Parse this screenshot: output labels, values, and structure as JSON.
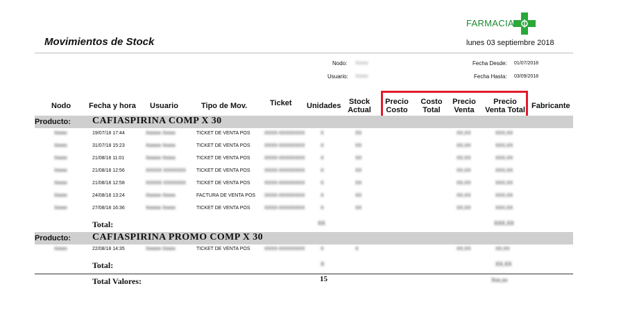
{
  "logo": {
    "text": "FARMACIA",
    "cross_color": "#2aa83a"
  },
  "report": {
    "title": "Movimientos de Stock",
    "date": "lunes 03 septiembre 2018"
  },
  "meta": {
    "nodo_label": "Nodo:",
    "nodo_value": "Xxxxx",
    "usuario_label": "Usuario:",
    "usuario_value": "Xxxxx",
    "fecha_desde_label": "Fecha Desde:",
    "fecha_desde_value": "01/07/2018",
    "fecha_hasta_label": "Fecha Hasta:",
    "fecha_hasta_value": "03/09/2018"
  },
  "columns": {
    "nodo": "Nodo",
    "fecha": "Fecha y hora",
    "usuario": "Usuario",
    "tipo": "Tipo de Mov.",
    "ticket": "Ticket",
    "unidades": "Unidades",
    "stock_1": "Stock",
    "stock_2": "Actual",
    "precio_costo_1": "Precio",
    "precio_costo_2": "Costo",
    "costo_total_1": "Costo",
    "costo_total_2": "Total",
    "precio_venta_1": "Precio",
    "precio_venta_2": "Venta",
    "pvt_1": "Precio",
    "pvt_2": "Venta Total",
    "fabricante": "Fabricante"
  },
  "highlight_color": "#e21b2a",
  "product_label": "Producto:",
  "total_label": "Total:",
  "total_valores_label": "Total Valores:",
  "total_valores_unidades": "15",
  "total_valores_venta": "Xxx,xx",
  "products": [
    {
      "name": "CAFIASPIRINA COMP X  30",
      "rows": [
        {
          "nodo": "Xxxxx",
          "fecha": "19/07/18 17:44",
          "usuario": "Xxxxxx Xxxxx",
          "tipo": "TICKET DE VENTA POS",
          "ticket": "XXXX-XXXXXXXX",
          "unidades": "X",
          "stock": "XX",
          "precio_venta": "XX,XX",
          "pvt": "XXX,XX"
        },
        {
          "nodo": "Xxxxx",
          "fecha": "31/07/18 15:23",
          "usuario": "Xxxxxx Xxxxx",
          "tipo": "TICKET DE VENTA POS",
          "ticket": "XXXX-XXXXXXXX",
          "unidades": "X",
          "stock": "XX",
          "precio_venta": "XX,XX",
          "pvt": "XXX,XX"
        },
        {
          "nodo": "Xxxxx",
          "fecha": "21/08/18 11:01",
          "usuario": "Xxxxxx Xxxxx",
          "tipo": "TICKET DE VENTA POS",
          "ticket": "XXXX-XXXXXXXX",
          "unidades": "X",
          "stock": "XX",
          "precio_venta": "XX,XX",
          "pvt": "XXX,XX"
        },
        {
          "nodo": "Xxxxx",
          "fecha": "21/08/18 12:56",
          "usuario": "XXXXX XXXXXXX",
          "tipo": "TICKET DE VENTA POS",
          "ticket": "XXXX-XXXXXXXX",
          "unidades": "X",
          "stock": "XX",
          "precio_venta": "XX,XX",
          "pvt": "XXX,XX"
        },
        {
          "nodo": "Xxxxx",
          "fecha": "21/08/18 12:58",
          "usuario": "XXXXX XXXXXXX",
          "tipo": "TICKET DE VENTA POS",
          "ticket": "XXXX-XXXXXXXX",
          "unidades": "X",
          "stock": "XX",
          "precio_venta": "XX,XX",
          "pvt": "XXX,XX"
        },
        {
          "nodo": "Xxxxx",
          "fecha": "24/08/18 13:24",
          "usuario": "Xxxxxx Xxxxx",
          "tipo": "FACTURA DE VENTA POS",
          "ticket": "XXXX-XXXXXXXX",
          "unidades": "X",
          "stock": "XX",
          "precio_venta": "XX,XX",
          "pvt": "XXX,XX"
        },
        {
          "nodo": "Xxxxx",
          "fecha": "27/08/18 16:36",
          "usuario": "Xxxxxx Xxxxx",
          "tipo": "TICKET DE VENTA POS",
          "ticket": "XXXX-XXXXXXXX",
          "unidades": "X",
          "stock": "XX",
          "precio_venta": "XX,XX",
          "pvt": "XXX,XX"
        }
      ],
      "total_unidades": "XX",
      "total_pvt": "XXX,XX"
    },
    {
      "name": "CAFIASPIRINA PROMO COMP X  30",
      "rows": [
        {
          "nodo": "Xxxxx",
          "fecha": "22/08/18 14:35",
          "usuario": "Xxxxxx Xxxxx",
          "tipo": "TICKET DE VENTA POS",
          "ticket": "XXXX-XXXXXXXX",
          "unidades": "X",
          "stock": "X",
          "precio_venta": "XX,XX",
          "pvt": "XX,XX"
        }
      ],
      "total_unidades": "X",
      "total_pvt": "XX,XX"
    }
  ]
}
